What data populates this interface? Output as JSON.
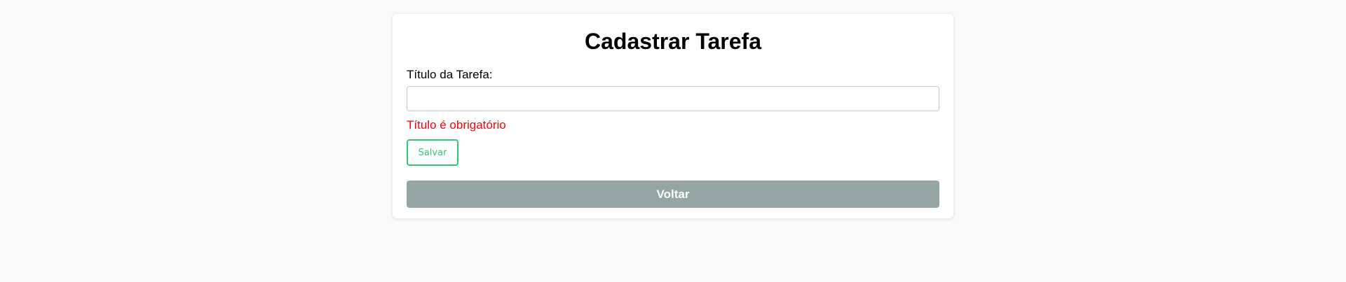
{
  "form": {
    "title": "Cadastrar Tarefa",
    "field_label": "Título da Tarefa:",
    "field_value": "",
    "field_placeholder": "",
    "error_message": "Título é obrigatório",
    "save_label": "Salvar",
    "back_label": "Voltar"
  },
  "colors": {
    "background": "#f9f9f9",
    "card": "#ffffff",
    "error": "#ff0000",
    "save_accent": "#2ecc71",
    "back_button": "#95a5a6"
  }
}
